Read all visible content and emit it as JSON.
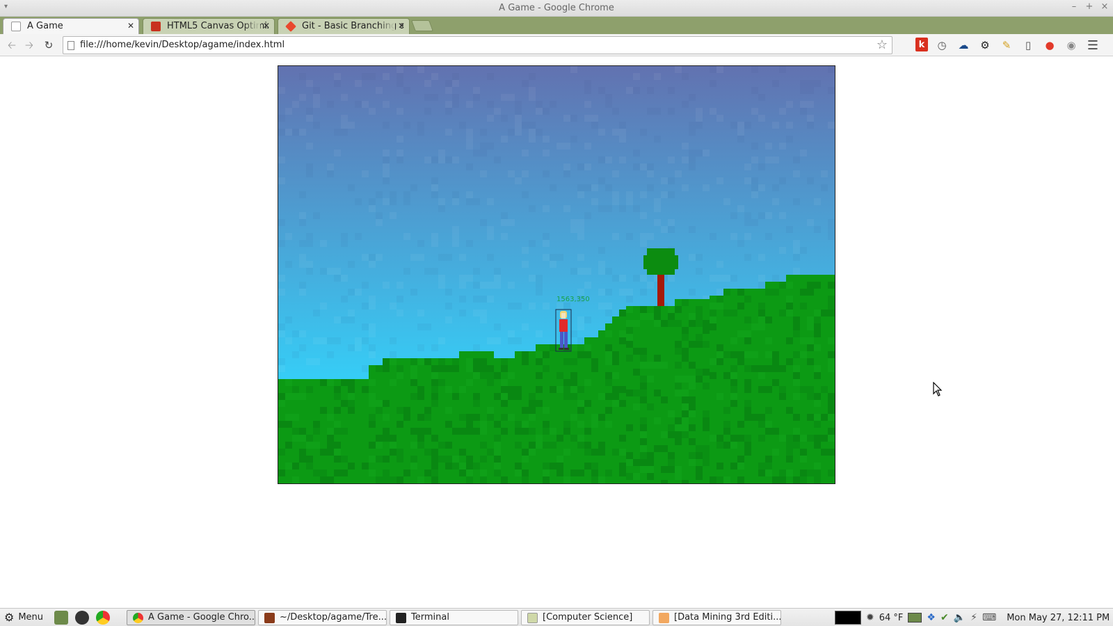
{
  "window": {
    "title": "A Game - Google Chrome"
  },
  "tabs": [
    {
      "label": "A Game",
      "icon": "page-icon",
      "active": true
    },
    {
      "label": "HTML5 Canvas Optimiz",
      "icon": "html5-rocks-icon",
      "active": false
    },
    {
      "label": "Git - Basic Branching ar",
      "icon": "git-icon",
      "active": false
    }
  ],
  "toolbar": {
    "url": "file:///home/kevin/Desktop/agame/index.html",
    "extensions": [
      "k-extension-icon",
      "clock-extension-icon",
      "cloud-extension-icon",
      "gear-extension-icon",
      "feather-extension-icon",
      "book-extension-icon",
      "record-extension-icon",
      "download-extension-icon",
      "chrome-menu-icon"
    ]
  },
  "game": {
    "player_coords_label": "1563,350",
    "colors": {
      "sky_top": "#6272b0",
      "sky_bottom": "#36cdf6",
      "grass": "#0c9a14",
      "tree_trunk": "#a61a08",
      "tree_leaves": "#0c8c10",
      "player_shirt": "#e22a2a",
      "player_pants": "#4a58c8",
      "player_hair": "#f2d676",
      "coords_text": "#19a34a"
    }
  },
  "taskbar": {
    "menu_label": "Menu",
    "tasks": [
      {
        "label": "A Game - Google Chro...",
        "icon": "chrome-icon",
        "active": true
      },
      {
        "label": "~/Desktop/agame/Tre...",
        "icon": "editor-icon",
        "active": false
      },
      {
        "label": "Terminal",
        "icon": "terminal-icon",
        "active": false
      },
      {
        "label": "[Computer Science]",
        "icon": "folder-icon",
        "active": false
      },
      {
        "label": "[Data Mining 3rd Editi...",
        "icon": "document-icon",
        "active": false
      }
    ],
    "weather": "64 °F",
    "clock": "Mon May 27, 12:11 PM"
  }
}
